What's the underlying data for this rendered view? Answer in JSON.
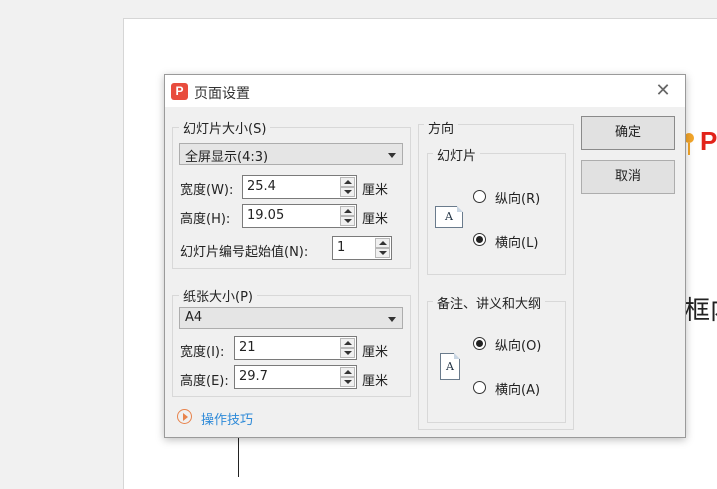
{
  "background": {
    "brand_letter": "P",
    "text_fragment": "框内"
  },
  "dialog": {
    "title": "页面设置",
    "app_icon_letter": "P",
    "close_symbol": "✕",
    "slide_size": {
      "legend": "幻灯片大小(S)",
      "preset": "全屏显示(4:3)",
      "width_label": "宽度(W):",
      "width_value": "25.4",
      "height_label": "高度(H):",
      "height_value": "19.05",
      "start_number_label": "幻灯片编号起始值(N):",
      "start_number_value": "1",
      "unit": "厘米"
    },
    "paper_size": {
      "legend": "纸张大小(P)",
      "preset": "A4",
      "width_label": "宽度(I):",
      "width_value": "21",
      "height_label": "高度(E):",
      "height_value": "29.7",
      "unit": "厘米"
    },
    "orientation": {
      "legend": "方向",
      "slides": {
        "legend": "幻灯片",
        "icon_letter": "A",
        "portrait_label": "纵向(R)",
        "landscape_label": "横向(L)",
        "selected": "landscape"
      },
      "notes": {
        "legend": "备注、讲义和大纲",
        "icon_letter": "A",
        "portrait_label": "纵向(O)",
        "landscape_label": "横向(A)",
        "selected": "portrait"
      }
    },
    "buttons": {
      "ok": "确定",
      "cancel": "取消"
    },
    "help_link": "操作技巧"
  }
}
